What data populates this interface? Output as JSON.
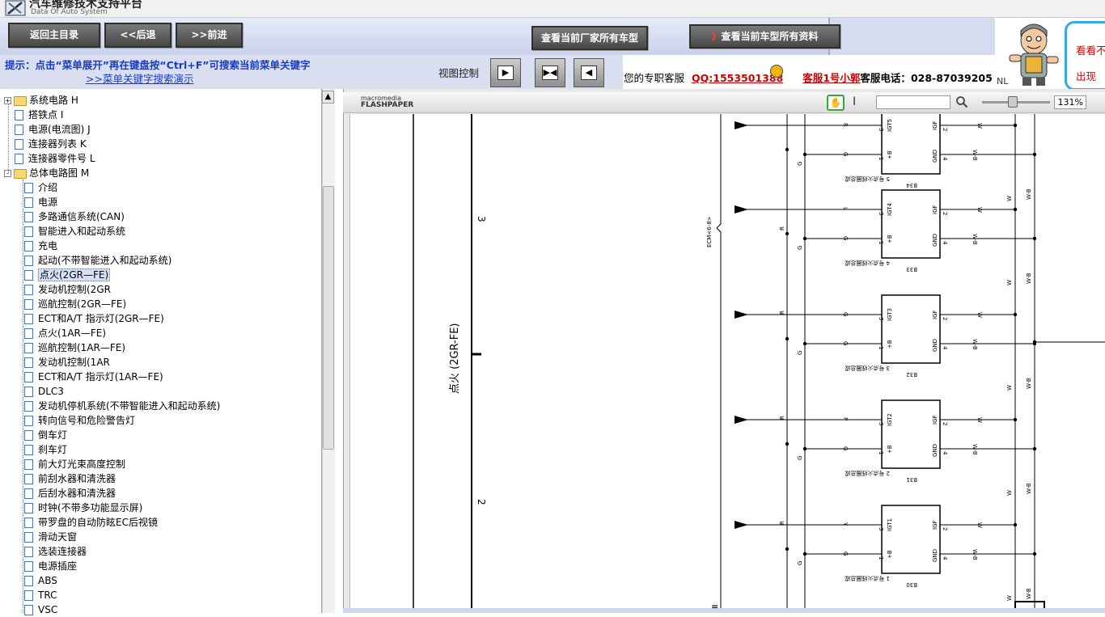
{
  "header": {
    "title": "汽车维修技术支持平台",
    "subtitle": "Data Of Auto System"
  },
  "nav": {
    "home": "返回主目录",
    "back": "<<后退",
    "forward": ">>前进",
    "view_models": "查看当前厂家所有车型",
    "view_all_prefix": "》",
    "view_all": "查看当前车型所有资料"
  },
  "hint": {
    "text": "提示：点击“菜单展开”再在键盘按“Ctrl+F”可搜索当前菜单关键字",
    "link": ">>菜单关键字搜索演示"
  },
  "view_control": {
    "label": "视图控制"
  },
  "service": {
    "intro": "您的专职客服",
    "qq": "QQ:1553501388",
    "agent": "客服1号小郭",
    "phone_label": "客服电话：",
    "phone": "028-87039205"
  },
  "ad": {
    "line1": "看看不",
    "line2": "出现"
  },
  "ad_partial": "NL",
  "tree": {
    "items": [
      {
        "label": "系统电路  H",
        "type": "folder",
        "expander": "+",
        "level": 0
      },
      {
        "label": "搭铁点  I",
        "type": "doc",
        "level": 0
      },
      {
        "label": "电源(电流图) J",
        "type": "doc",
        "level": 0
      },
      {
        "label": "连接器列表  K",
        "type": "doc",
        "level": 0
      },
      {
        "label": "连接器零件号  L",
        "type": "doc",
        "level": 0
      },
      {
        "label": "总体电路图  M",
        "type": "folder",
        "expander": "-",
        "level": 0
      },
      {
        "label": "介绍",
        "type": "doc",
        "level": 1
      },
      {
        "label": "电源",
        "type": "doc",
        "level": 1
      },
      {
        "label": "多路通信系统(CAN)",
        "type": "doc",
        "level": 1
      },
      {
        "label": "智能进入和起动系统",
        "type": "doc",
        "level": 1
      },
      {
        "label": "充电",
        "type": "doc",
        "level": 1
      },
      {
        "label": "起动(不带智能进入和起动系统)",
        "type": "doc",
        "level": 1
      },
      {
        "label": "点火(2GR—FE)",
        "type": "doc",
        "level": 1,
        "selected": true
      },
      {
        "label": "发动机控制(2GR",
        "type": "doc",
        "level": 1
      },
      {
        "label": "巡航控制(2GR—FE)",
        "type": "doc",
        "level": 1
      },
      {
        "label": "ECT和A/T 指示灯(2GR—FE)",
        "type": "doc",
        "level": 1
      },
      {
        "label": "点火(1AR—FE)",
        "type": "doc",
        "level": 1
      },
      {
        "label": "巡航控制(1AR—FE)",
        "type": "doc",
        "level": 1
      },
      {
        "label": "发动机控制(1AR",
        "type": "doc",
        "level": 1
      },
      {
        "label": "ECT和A/T 指示灯(1AR—FE)",
        "type": "doc",
        "level": 1
      },
      {
        "label": "DLC3",
        "type": "doc",
        "level": 1
      },
      {
        "label": "发动机停机系统(不带智能进入和起动系统)",
        "type": "doc",
        "level": 1
      },
      {
        "label": "转向信号和危险警告灯",
        "type": "doc",
        "level": 1
      },
      {
        "label": "倒车灯",
        "type": "doc",
        "level": 1
      },
      {
        "label": "刹车灯",
        "type": "doc",
        "level": 1
      },
      {
        "label": "前大灯光束高度控制",
        "type": "doc",
        "level": 1
      },
      {
        "label": "前刮水器和清洗器",
        "type": "doc",
        "level": 1
      },
      {
        "label": "后刮水器和清洗器",
        "type": "doc",
        "level": 1
      },
      {
        "label": "时钟(不带多功能显示屏)",
        "type": "doc",
        "level": 1
      },
      {
        "label": "带罗盘的自动防眩EC后视镜",
        "type": "doc",
        "level": 1
      },
      {
        "label": "滑动天窗",
        "type": "doc",
        "level": 1
      },
      {
        "label": "选装连接器",
        "type": "doc",
        "level": 1
      },
      {
        "label": "电源插座",
        "type": "doc",
        "level": 1
      },
      {
        "label": "ABS",
        "type": "doc",
        "level": 1
      },
      {
        "label": "TRC",
        "type": "doc",
        "level": 1
      },
      {
        "label": "VSC",
        "type": "doc",
        "level": 1
      }
    ]
  },
  "flashpaper": {
    "brand_small": "macromedia",
    "brand": "FLASHPAPER",
    "zoom": "131%"
  },
  "diagram": {
    "title": "点火 (2GR-FE)",
    "page_marks": [
      "3",
      "2"
    ],
    "ecm_label": "ECM<6-8>",
    "coils": [
      {
        "name": "B34",
        "sub": "5 号点火线圈总成",
        "igt": "IGT5",
        "sig_wire": "R"
      },
      {
        "name": "B33",
        "sub": "4 号点火线圈总成",
        "igt": "IGT4",
        "sig_wire": "L"
      },
      {
        "name": "B32",
        "sub": "3 号点火线圈总成",
        "igt": "IGT3",
        "sig_wire": "G"
      },
      {
        "name": "B31",
        "sub": "2 号点火线圈总成",
        "igt": "IGT2",
        "sig_wire": "P"
      },
      {
        "name": "B30",
        "sub": "1 号点火线圈总成",
        "igt": "IGT1",
        "sig_wire": "Y"
      }
    ],
    "pin_labels": {
      "b": "+B",
      "gnd": "GND",
      "igf": "IGF",
      "p1": "1",
      "p2": "2",
      "p3": "3",
      "p4": "4"
    },
    "wire_labels": {
      "r": "R",
      "g": "G",
      "w": "W",
      "wb": "W-B"
    }
  }
}
